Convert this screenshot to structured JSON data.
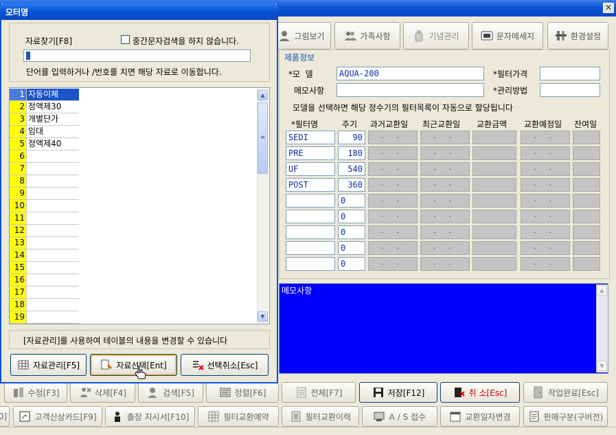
{
  "window": {
    "close_glyph": "✕"
  },
  "toolbar": [
    {
      "label": "그림보기",
      "icon": "picture-icon"
    },
    {
      "label": "가족사항",
      "icon": "family-icon"
    },
    {
      "label": "기념관리",
      "icon": "bottle-icon"
    },
    {
      "label": "문자메세지",
      "icon": "sms-icon"
    },
    {
      "label": "환경설정",
      "icon": "settings-icon"
    }
  ],
  "product": {
    "section_title": "제품정보",
    "model_label": "*모  델",
    "model_value": "AQUA-200",
    "filter_price_label": "*필터가격",
    "filter_price_value": "",
    "memo_label": "메모사항",
    "memo_value": "",
    "manage_label": "*관리방법",
    "manage_value": "",
    "hint": "모델을 선택하면 해당 정수기의 필터목록이 자동으로 할당됩니다",
    "filter_columns": [
      "*필터명",
      "주기",
      "과거교환일",
      "최근교환일",
      "교환금액",
      "교환예정일",
      "잔여일"
    ],
    "filters": [
      {
        "name": "SEDI",
        "cycle": "90"
      },
      {
        "name": "PRE",
        "cycle": "180"
      },
      {
        "name": "UF",
        "cycle": "540"
      },
      {
        "name": "POST",
        "cycle": "360"
      },
      {
        "name": "",
        "cycle": "0"
      },
      {
        "name": "",
        "cycle": "0"
      },
      {
        "name": "",
        "cycle": "0"
      },
      {
        "name": "",
        "cycle": "0"
      },
      {
        "name": "",
        "cycle": "0"
      }
    ],
    "date_placeholder": ". ."
  },
  "memo_area": {
    "text": "메모사항"
  },
  "bottom_row1": [
    {
      "label": "수정[F3]",
      "icon": "edit-icon"
    },
    {
      "label": "삭제[F4]",
      "icon": "delete-icon"
    },
    {
      "label": "검색[F5]",
      "icon": "search-icon"
    },
    {
      "label": "정렬[F6]",
      "icon": "sort-icon"
    },
    {
      "label": "전체[F7]",
      "icon": "list-icon"
    },
    {
      "label": "저장[F12]",
      "icon": "save-icon"
    },
    {
      "label": "취 소[Esc]",
      "icon": "cancel-icon"
    },
    {
      "label": "작업완료[Esc]",
      "icon": "door-icon"
    }
  ],
  "bottom_row2": [
    {
      "label": "0]",
      "icon": ""
    },
    {
      "label": "고객신상카드[F9]",
      "icon": "card-icon"
    },
    {
      "label": "출장 지시서[F10]",
      "icon": "worker-icon"
    },
    {
      "label": "필터교환예약",
      "icon": "grid-icon"
    },
    {
      "label": "필터교환이력",
      "icon": "history-icon"
    },
    {
      "label": "A / S 접수",
      "icon": "service-icon"
    },
    {
      "label": "교환일자변경",
      "icon": "calendar-icon"
    },
    {
      "label": "판매구분(구버전)",
      "icon": "doc-icon"
    }
  ],
  "dialog": {
    "title": "모터명",
    "search_label": "자료찾기[F8]",
    "checkbox_label": "중간문자검색을 하지 않습니다.",
    "checkbox_checked": false,
    "search_hint": "단어를 입력하거나  /번호를 치면 해당 자료로 이동합니다.",
    "rows": [
      {
        "n": "1",
        "text": "자동이체"
      },
      {
        "n": "2",
        "text": "정액제30"
      },
      {
        "n": "3",
        "text": "개별단가"
      },
      {
        "n": "4",
        "text": "임대"
      },
      {
        "n": "5",
        "text": "정액제40"
      },
      {
        "n": "6",
        "text": ""
      },
      {
        "n": "7",
        "text": ""
      },
      {
        "n": "8",
        "text": ""
      },
      {
        "n": "9",
        "text": ""
      },
      {
        "n": "10",
        "text": ""
      },
      {
        "n": "11",
        "text": ""
      },
      {
        "n": "12",
        "text": ""
      },
      {
        "n": "13",
        "text": ""
      },
      {
        "n": "14",
        "text": ""
      },
      {
        "n": "15",
        "text": ""
      },
      {
        "n": "16",
        "text": ""
      },
      {
        "n": "17",
        "text": ""
      },
      {
        "n": "18",
        "text": ""
      },
      {
        "n": "19",
        "text": ""
      }
    ],
    "selected_index": 0,
    "footer_hint": "[자료관리]를 사용하여 테이블의 내용을 변경할 수 있습니다",
    "buttons": [
      {
        "label": "자료관리[F5]",
        "icon": "table-icon"
      },
      {
        "label": "자료선택[Ent]",
        "icon": "select-icon"
      },
      {
        "label": "선택취소[Esc]",
        "icon": "uncheck-icon"
      }
    ]
  }
}
